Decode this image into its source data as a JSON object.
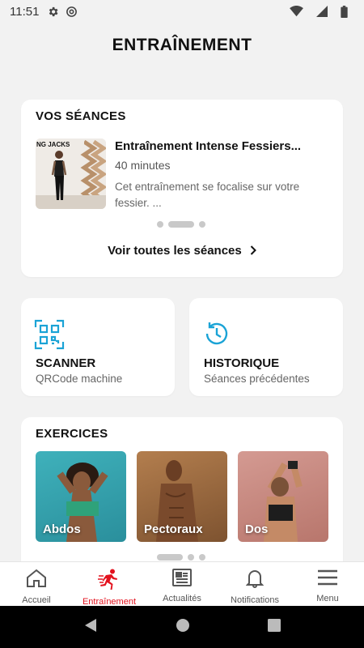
{
  "status_bar": {
    "time": "11:51"
  },
  "header": {
    "title": "ENTRAÎNEMENT"
  },
  "sessions": {
    "heading": "VOS SÉANCES",
    "items": [
      {
        "thumb_caption": "NG JACKS",
        "title": "Entraînement Intense Fessiers...",
        "duration": "40 minutes",
        "description": "Cet entraînement se focalise sur votre fessier. ..."
      }
    ],
    "see_all": "Voir toutes les séances"
  },
  "tiles": {
    "scanner": {
      "title": "SCANNER",
      "subtitle": "QRCode machine",
      "icon": "qr-code-icon"
    },
    "history": {
      "title": "HISTORIQUE",
      "subtitle": "Séances précédentes",
      "icon": "history-icon"
    }
  },
  "exercises": {
    "heading": "EXERCICES",
    "items": [
      {
        "label": "Abdos"
      },
      {
        "label": "Pectoraux"
      },
      {
        "label": "Dos"
      }
    ]
  },
  "bottom_nav": {
    "items": [
      {
        "label": "Accueil",
        "icon": "home-icon"
      },
      {
        "label": "Entraînement",
        "icon": "running-icon",
        "active": true
      },
      {
        "label": "Actualités",
        "icon": "news-icon"
      },
      {
        "label": "Notifications",
        "icon": "bell-icon"
      },
      {
        "label": "Menu",
        "icon": "menu-icon"
      }
    ]
  },
  "colors": {
    "accent": "#e3121e",
    "tile_icon": "#1aa3d6",
    "background": "#f2f2f2"
  }
}
